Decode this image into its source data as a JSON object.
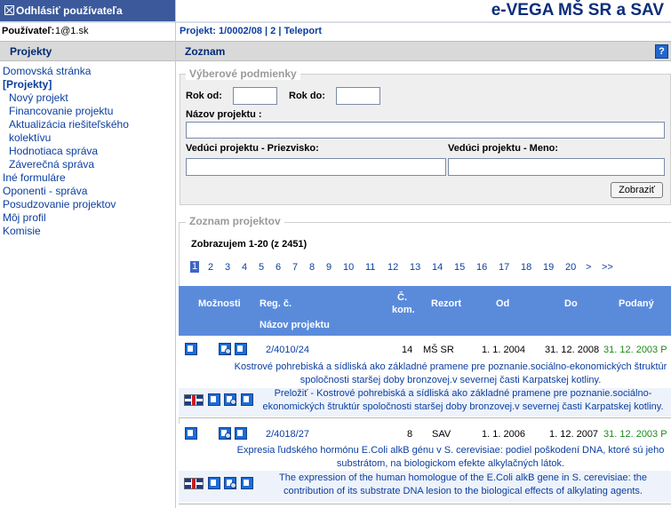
{
  "header": {
    "logout_label": "Odhlásiť používateľa",
    "brand": "e-VEGA MŠ SR a SAV",
    "user_label": "Používateľ:",
    "user_value": "1@1.sk",
    "project_label": "Projekt:",
    "project_link": "1/0002/08 | 2 | Teleport"
  },
  "sidebar": {
    "title": "Projekty",
    "items": [
      {
        "label": "Domovská stránka"
      },
      {
        "label": "[Projekty]"
      },
      {
        "label": "Nový projekt"
      },
      {
        "label": "Financovanie projektu"
      },
      {
        "label": "Aktualizácia riešiteľského"
      },
      {
        "label": "kolektívu"
      },
      {
        "label": "Hodnotiaca správa"
      },
      {
        "label": "Záverečná správa"
      },
      {
        "label": "Iné formuláre"
      },
      {
        "label": "Oponenti - správa"
      },
      {
        "label": "Posudzovanie projektov"
      },
      {
        "label": "Môj profil"
      },
      {
        "label": "Komisie"
      }
    ]
  },
  "main": {
    "title": "Zoznam",
    "help": "?",
    "filter": {
      "legend": "Výberové podmienky",
      "year_from": "Rok od:",
      "year_to": "Rok do:",
      "name": "Názov projektu :",
      "lead_surname": "Vedúci projektu - Priezvisko:",
      "lead_name": "Vedúci projektu - Meno:",
      "show_button": "Zobraziť"
    },
    "list": {
      "legend": "Zoznam projektov",
      "showing": "Zobrazujem 1-20 (z 2451)",
      "pages": [
        "1",
        "2",
        "3",
        "4",
        "5",
        "6",
        "7",
        "8",
        "9",
        "10",
        "11",
        "12",
        "13",
        "14",
        "15",
        "16",
        "17",
        "18",
        "19",
        "20",
        ">",
        ">>"
      ],
      "columns": {
        "options": "Možnosti",
        "reg": "Reg. č.",
        "name": "Názov projektu",
        "kom1": "Č.",
        "kom2": "kom.",
        "rezort": "Rezort",
        "od": "Od",
        "do": "Do",
        "podany": "Podaný"
      },
      "rows": [
        {
          "reg": "2/4010/24",
          "kom": "14",
          "rezort": "MŠ SR",
          "od": "1. 1. 2004",
          "do": "31. 12. 2008",
          "podany": "31. 12. 2003 P",
          "title_sk": "Kostrové pohrebiská a sídliská ako základné pramene pre poznanie.sociálno-ekonomických štruktúr spoločnosti staršej doby bronzovej.v severnej časti Karpatskej kotliny.",
          "title_en": "Preložiť - Kostrové pohrebiská a sídliská ako základné pramene pre poznanie.sociálno-ekonomických štruktúr spoločnosti staršej doby bronzovej.v severnej časti Karpatskej kotliny."
        },
        {
          "reg": "2/4018/27",
          "kom": "8",
          "rezort": "SAV",
          "od": "1. 1. 2006",
          "do": "1. 12. 2007",
          "podany": "31. 12. 2003 P",
          "title_sk": "Expresia ľudského hormónu E.Coli alkB génu v S. cerevisiae: podiel poškodení DNA, ktoré sú jeho substrátom, na biologickom efekte alkylačných látok.",
          "title_en": "The expression of the human homologue of the E.Coli alkB gene in S. cerevisiae: the contribution of its substrate DNA lesion to the biological effects of alkylating agents."
        }
      ]
    }
  }
}
